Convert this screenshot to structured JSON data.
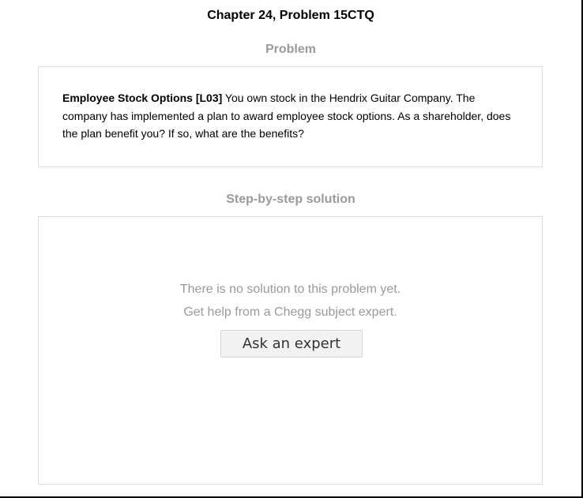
{
  "page": {
    "title": "Chapter 24, Problem 15CTQ"
  },
  "problem": {
    "heading": "Problem",
    "lead": "Employee Stock Options [L03]",
    "body": " You own stock in the Hendrix Guitar Company. The company has implemented a plan to award employee stock options. As a shareholder, does the plan benefit you? If so, what are the benefits?"
  },
  "solution": {
    "heading": "Step-by-step solution",
    "no_solution_line1": "There is no solution to this problem yet.",
    "no_solution_line2": "Get help from a Chegg subject expert.",
    "ask_button_label": "Ask an expert"
  }
}
